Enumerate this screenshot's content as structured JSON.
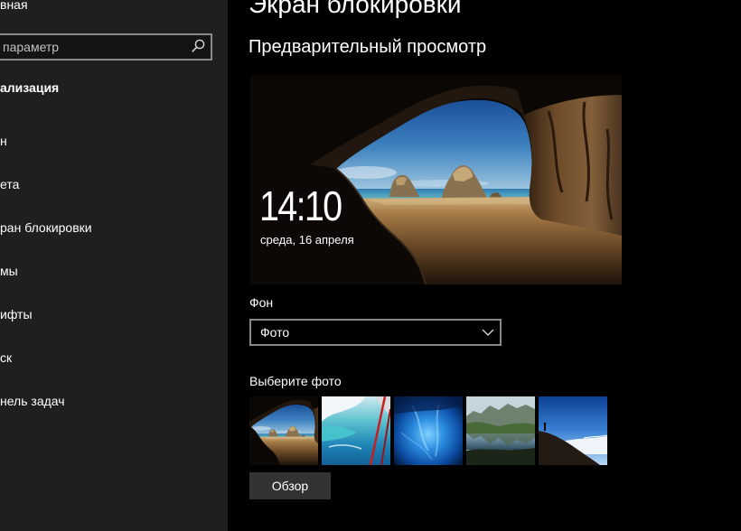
{
  "sidebar": {
    "home_label": "вная",
    "search": {
      "placeholder": "параметр",
      "icon": "search-icon"
    },
    "section_title": "ализация",
    "items": [
      {
        "label": "н"
      },
      {
        "label": "ета"
      },
      {
        "label": "ран блокировки"
      },
      {
        "label": "мы"
      },
      {
        "label": "ифты"
      },
      {
        "label": "ск"
      },
      {
        "label": "нель задач"
      }
    ]
  },
  "main": {
    "page_title": "Экран блокировки",
    "preview_heading": "Предварительный просмотр",
    "preview": {
      "time": "14:10",
      "date": "среда, 16 апреля"
    },
    "background": {
      "label": "Фон",
      "selected": "Фото",
      "icon": "chevron-down-icon"
    },
    "choose_photo_label": "Выберите фото",
    "browse_button": "Обзор"
  },
  "colors": {
    "sidebar_bg": "#1f1f1f",
    "main_bg": "#000000",
    "text": "#ffffff",
    "field_border": "#8a8a8a",
    "button_bg": "#333333"
  }
}
